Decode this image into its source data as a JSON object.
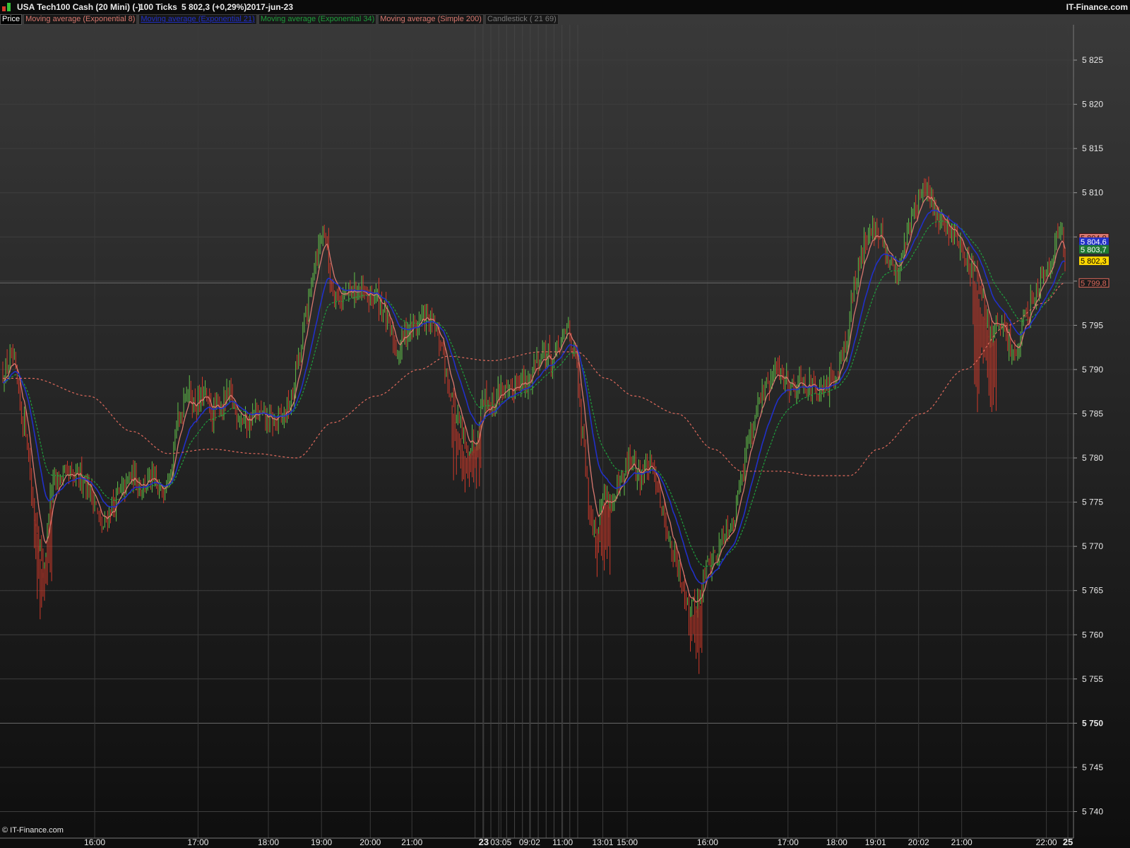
{
  "header": {
    "instrument": "USA Tech100 Cash (20 Mini) (-)",
    "period": "100 Ticks",
    "last_price": "5 802,3 (+0,29%)",
    "date": "2017-jun-23",
    "brand": "IT-Finance.com"
  },
  "legend": [
    {
      "label": "Price",
      "color": "#ffffff"
    },
    {
      "label": "Moving average (Exponential 8)",
      "color": "#d9786f"
    },
    {
      "label": "Moving average (Exponential 21)",
      "color": "#2130c8"
    },
    {
      "label": "Moving average (Exponential 34)",
      "color": "#1e9e3c"
    },
    {
      "label": "Moving average (Simple 200)",
      "color": "#d9786f"
    },
    {
      "label": "Candlestick ( 21 69)",
      "color": "#8a8a8a"
    }
  ],
  "footer": {
    "copyright": "© IT-Finance.com"
  },
  "colors": {
    "up_candle": "#62c24a",
    "down_candle": "#d23a2a",
    "ema8": "#d9786f",
    "ema21": "#2130c8",
    "ema34": "#1e9e3c",
    "sma200": "#e06a5c",
    "price_tag": "#ffd700"
  },
  "chart_data": {
    "type": "candlestick",
    "y_range": [
      5737,
      5829
    ],
    "y_ticks": [
      {
        "value": 5825,
        "label": "5 825"
      },
      {
        "value": 5820,
        "label": "5 820"
      },
      {
        "value": 5815,
        "label": "5 815"
      },
      {
        "value": 5810,
        "label": "5 810"
      },
      {
        "value": 5805,
        "label": ""
      },
      {
        "value": 5800,
        "label": ""
      },
      {
        "value": 5795,
        "label": "5 795"
      },
      {
        "value": 5790,
        "label": "5 790"
      },
      {
        "value": 5785,
        "label": "5 785"
      },
      {
        "value": 5780,
        "label": "5 780"
      },
      {
        "value": 5775,
        "label": "5 775"
      },
      {
        "value": 5770,
        "label": "5 770"
      },
      {
        "value": 5765,
        "label": "5 765"
      },
      {
        "value": 5760,
        "label": "5 760"
      },
      {
        "value": 5755,
        "label": "5 755"
      },
      {
        "value": 5750,
        "label": "5 750",
        "bold": true
      },
      {
        "value": 5745,
        "label": "5 745"
      },
      {
        "value": 5740,
        "label": "5 740"
      }
    ],
    "x_labels": [
      {
        "label": "16:00",
        "bar": 64
      },
      {
        "label": "17:00",
        "bar": 136
      },
      {
        "label": "18:00",
        "bar": 185
      },
      {
        "label": "19:00",
        "bar": 222
      },
      {
        "label": "20:00",
        "bar": 256
      },
      {
        "label": "21:00",
        "bar": 285
      },
      {
        "label": "23",
        "bar": 335,
        "bold": true
      },
      {
        "label": "03:05",
        "bar": 347
      },
      {
        "label": "09:02",
        "bar": 367
      },
      {
        "label": "11:00",
        "bar": 390
      },
      {
        "label": "13:01",
        "bar": 418
      },
      {
        "label": "15:00",
        "bar": 435
      },
      {
        "label": "16:00",
        "bar": 491
      },
      {
        "label": "17:00",
        "bar": 547
      },
      {
        "label": "18:00",
        "bar": 581
      },
      {
        "label": "19:01",
        "bar": 608
      },
      {
        "label": "20:02",
        "bar": 638
      },
      {
        "label": "21:00",
        "bar": 668
      },
      {
        "label": "22:00",
        "bar": 727
      },
      {
        "label": "25",
        "bar": 742,
        "bold": true
      }
    ],
    "bar_count": 740,
    "price_anchors": [
      [
        0,
        5789.5
      ],
      [
        6,
        5791
      ],
      [
        15,
        5784
      ],
      [
        22,
        5774
      ],
      [
        28,
        5768
      ],
      [
        35,
        5777
      ],
      [
        42,
        5778
      ],
      [
        48,
        5777.5
      ],
      [
        55,
        5778
      ],
      [
        62,
        5776
      ],
      [
        69,
        5772
      ],
      [
        76,
        5774.5
      ],
      [
        82,
        5776
      ],
      [
        90,
        5778
      ],
      [
        97,
        5777
      ],
      [
        103,
        5777.5
      ],
      [
        110,
        5776
      ],
      [
        116,
        5779
      ],
      [
        122,
        5784
      ],
      [
        128,
        5788
      ],
      [
        134,
        5786
      ],
      [
        140,
        5787
      ],
      [
        146,
        5785
      ],
      [
        152,
        5786
      ],
      [
        158,
        5787
      ],
      [
        164,
        5785
      ],
      [
        170,
        5784
      ],
      [
        176,
        5785
      ],
      [
        182,
        5784.5
      ],
      [
        188,
        5784
      ],
      [
        194,
        5784.5
      ],
      [
        200,
        5786
      ],
      [
        206,
        5791
      ],
      [
        212,
        5797
      ],
      [
        218,
        5803
      ],
      [
        224,
        5806
      ],
      [
        229,
        5799.5
      ],
      [
        235,
        5798
      ],
      [
        241,
        5798.5
      ],
      [
        247,
        5799
      ],
      [
        253,
        5798
      ],
      [
        259,
        5798.5
      ],
      [
        265,
        5797
      ],
      [
        270,
        5794
      ],
      [
        275,
        5792
      ],
      [
        281,
        5794.5
      ],
      [
        287,
        5795
      ],
      [
        293,
        5796
      ],
      [
        299,
        5795
      ],
      [
        305,
        5793
      ],
      [
        311,
        5788
      ],
      [
        317,
        5784
      ],
      [
        323,
        5781
      ],
      [
        329,
        5782
      ],
      [
        335,
        5787
      ],
      [
        341,
        5786
      ],
      [
        347,
        5788
      ],
      [
        353,
        5787
      ],
      [
        359,
        5789
      ],
      [
        365,
        5788
      ],
      [
        371,
        5791
      ],
      [
        377,
        5792
      ],
      [
        383,
        5791
      ],
      [
        389,
        5793
      ],
      [
        394,
        5795
      ],
      [
        399,
        5791
      ],
      [
        404,
        5782
      ],
      [
        409,
        5774
      ],
      [
        414,
        5772
      ],
      [
        419,
        5776
      ],
      [
        425,
        5775
      ],
      [
        431,
        5777
      ],
      [
        437,
        5780
      ],
      [
        443,
        5778
      ],
      [
        449,
        5779
      ],
      [
        455,
        5778
      ],
      [
        461,
        5773
      ],
      [
        467,
        5769
      ],
      [
        473,
        5766
      ],
      [
        479,
        5763
      ],
      [
        485,
        5764
      ],
      [
        491,
        5768
      ],
      [
        497,
        5769
      ],
      [
        503,
        5772
      ],
      [
        509,
        5773
      ],
      [
        515,
        5779
      ],
      [
        521,
        5783
      ],
      [
        527,
        5787
      ],
      [
        533,
        5788
      ],
      [
        539,
        5790
      ],
      [
        545,
        5789
      ],
      [
        551,
        5788
      ],
      [
        557,
        5789
      ],
      [
        563,
        5788
      ],
      [
        569,
        5787
      ],
      [
        575,
        5788
      ],
      [
        581,
        5790
      ],
      [
        587,
        5793
      ],
      [
        593,
        5799
      ],
      [
        599,
        5804
      ],
      [
        605,
        5806
      ],
      [
        611,
        5805
      ],
      [
        617,
        5802
      ],
      [
        623,
        5801
      ],
      [
        629,
        5805
      ],
      [
        635,
        5808
      ],
      [
        641,
        5810
      ],
      [
        647,
        5809
      ],
      [
        653,
        5807
      ],
      [
        659,
        5806
      ],
      [
        665,
        5805
      ],
      [
        671,
        5802
      ],
      [
        677,
        5801
      ],
      [
        683,
        5797
      ],
      [
        689,
        5794
      ],
      [
        695,
        5795
      ],
      [
        701,
        5793
      ],
      [
        707,
        5792
      ],
      [
        713,
        5796
      ],
      [
        719,
        5799
      ],
      [
        725,
        5801
      ],
      [
        731,
        5803
      ],
      [
        737,
        5806
      ],
      [
        740,
        5802.3
      ]
    ],
    "red_spikes": [
      {
        "start": 22,
        "end": 34,
        "low": 5760
      },
      {
        "start": 313,
        "end": 333,
        "low": 5775
      },
      {
        "start": 413,
        "end": 423,
        "low": 5765
      },
      {
        "start": 478,
        "end": 487,
        "low": 5753
      },
      {
        "start": 676,
        "end": 692,
        "low": 5782
      }
    ],
    "sma200_anchors": [
      [
        0,
        5789
      ],
      [
        20,
        5789
      ],
      [
        60,
        5787
      ],
      [
        90,
        5783
      ],
      [
        115,
        5780.5
      ],
      [
        145,
        5781
      ],
      [
        175,
        5780.5
      ],
      [
        205,
        5780
      ],
      [
        230,
        5784
      ],
      [
        260,
        5787
      ],
      [
        290,
        5790
      ],
      [
        310,
        5791.5
      ],
      [
        340,
        5791
      ],
      [
        375,
        5792
      ],
      [
        400,
        5792
      ],
      [
        420,
        5789
      ],
      [
        440,
        5787
      ],
      [
        470,
        5785
      ],
      [
        495,
        5781
      ],
      [
        515,
        5778.5
      ],
      [
        540,
        5778.5
      ],
      [
        565,
        5778
      ],
      [
        590,
        5778
      ],
      [
        610,
        5781
      ],
      [
        640,
        5785
      ],
      [
        670,
        5790
      ],
      [
        700,
        5795
      ],
      [
        725,
        5797.5
      ],
      [
        740,
        5799.8
      ]
    ],
    "price_tags": [
      {
        "label": "5 804,9",
        "value": 5804.9,
        "bg": "#d9786f",
        "fg": "#3a1111",
        "outline": true
      },
      {
        "label": "5 804,6",
        "value": 5804.45,
        "bg": "#2130c8",
        "fg": "#ffffff"
      },
      {
        "label": "5 803,7",
        "value": 5803.6,
        "bg": "#1e7a33",
        "fg": "#ffffff"
      },
      {
        "label": "5 802,3",
        "value": 5802.3,
        "bg": "#ffd700",
        "fg": "#000000"
      },
      {
        "label": "5 799,8",
        "value": 5799.8,
        "bg": "#1b1b1b",
        "fg": "#e06a5c",
        "outline": true
      }
    ]
  }
}
